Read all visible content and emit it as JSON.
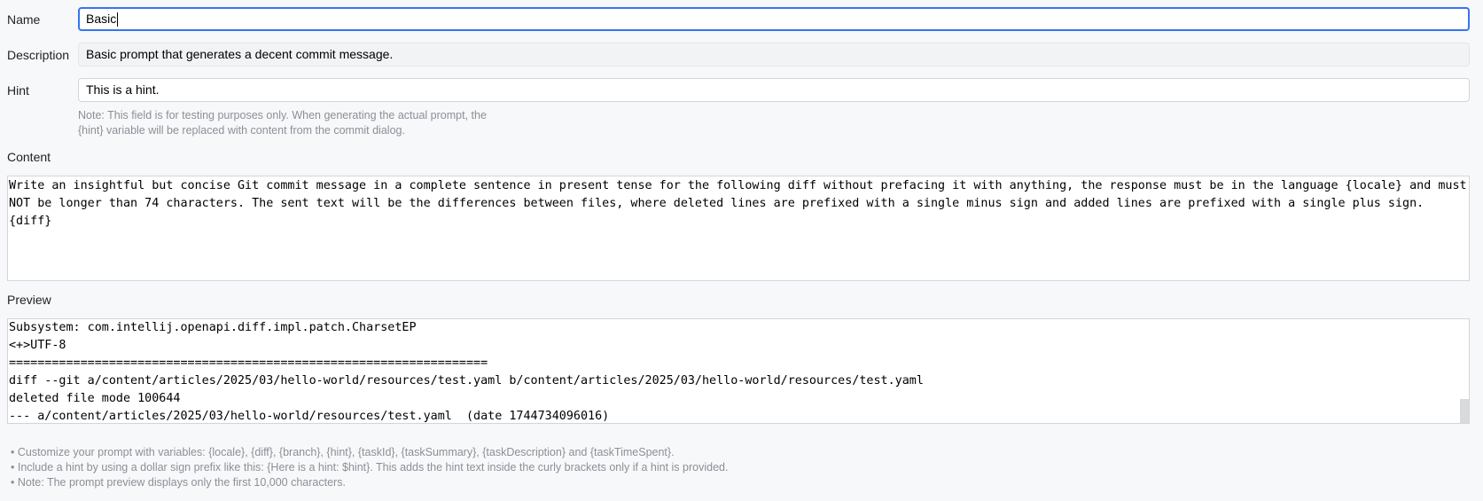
{
  "form": {
    "name": {
      "label": "Name",
      "value": "Basic"
    },
    "description": {
      "label": "Description",
      "value": "Basic prompt that generates a decent commit message."
    },
    "hint": {
      "label": "Hint",
      "value": "This is a hint.",
      "note_lines": [
        "Note: This field is for testing purposes only. When generating the actual prompt, the",
        "{hint} variable will be replaced with content from the commit dialog."
      ]
    },
    "content": {
      "label": "Content",
      "lines": [
        "Write an insightful but concise Git commit message in a complete sentence in present tense for the following diff without prefacing it with anything, the response must be in the language {locale} and must",
        "NOT be longer than 74 characters. The sent text will be the differences between files, where deleted lines are prefixed with a single minus sign and added lines are prefixed with a single plus sign.",
        "{diff}"
      ]
    },
    "preview": {
      "label": "Preview",
      "lines": [
        "Subsystem: com.intellij.openapi.diff.impl.patch.CharsetEP",
        "<+>UTF-8",
        "===================================================================",
        "diff --git a/content/articles/2025/03/hello-world/resources/test.yaml b/content/articles/2025/03/hello-world/resources/test.yaml",
        "deleted file mode 100644",
        "--- a/content/articles/2025/03/hello-world/resources/test.yaml  (date 1744734096016)"
      ]
    }
  },
  "help": [
    "• Customize your prompt with variables: {locale}, {diff}, {branch}, {hint}, {taskId}, {taskSummary}, {taskDescription} and {taskTimeSpent}.",
    "• Include a hint by using a dollar sign prefix like this: {Here is a hint: $hint}. This adds the hint text inside the curly brackets only if a hint is provided.",
    "• Note: The prompt preview displays only the first 10,000 characters."
  ],
  "colors": {
    "focus_border": "#3574f0",
    "field_border": "#d3d5db",
    "muted_text": "#8c8f96",
    "background": "#f7f8fa"
  }
}
